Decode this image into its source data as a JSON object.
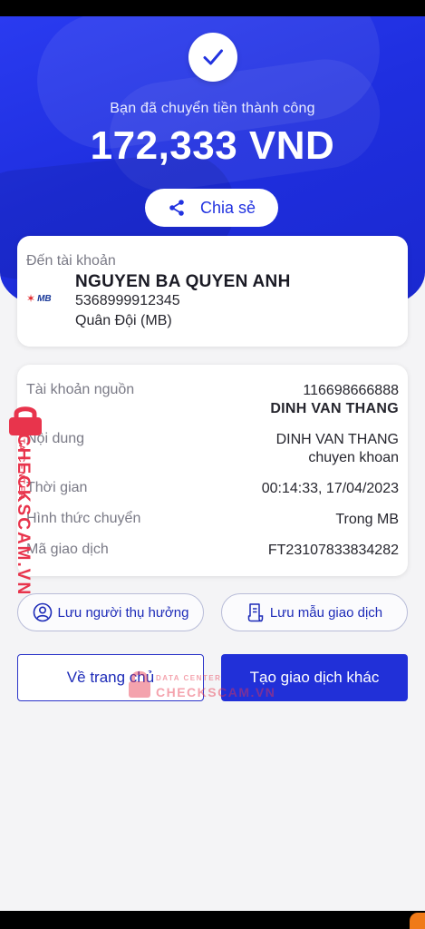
{
  "hero": {
    "success_message": "Bạn đã chuyển tiền thành công",
    "amount": "172,333 VND",
    "share_label": "Chia sẻ"
  },
  "recipient": {
    "label": "Đến tài khoản",
    "name": "NGUYEN BA QUYEN ANH",
    "account_number": "5368999912345",
    "bank_name": "Quân Đội (MB)",
    "bank_logo_text": "MB"
  },
  "details": [
    {
      "label": "Tài khoản nguồn",
      "value": "116698666888",
      "value2": "DINH VAN THANG"
    },
    {
      "label": "Nội dung",
      "value": "DINH VAN THANG",
      "value2": "chuyen khoan"
    },
    {
      "label": "Thời gian",
      "value": "00:14:33, 17/04/2023"
    },
    {
      "label": "Hình thức chuyển",
      "value": "Trong MB"
    },
    {
      "label": "Mã giao dịch",
      "value": "FT23107833834282"
    }
  ],
  "actions": {
    "save_recipient": "Lưu người thụ hưởng",
    "save_template": "Lưu mẫu giao dịch",
    "home": "Về trang chủ",
    "new_transaction": "Tạo giao dịch khác"
  },
  "watermark": {
    "brand": "CHECKSCAM.VN",
    "tagline": "DATA CENTER"
  },
  "colors": {
    "primary": "#2130d8",
    "hero_bg": "#2a3bf0",
    "watermark": "#e8344c",
    "bank_red": "#e0262a"
  },
  "icons": {
    "success": "check-icon",
    "share": "share-icon",
    "recipient": "user-circle-icon",
    "template": "document-icon",
    "watermark": "lock-icon"
  }
}
